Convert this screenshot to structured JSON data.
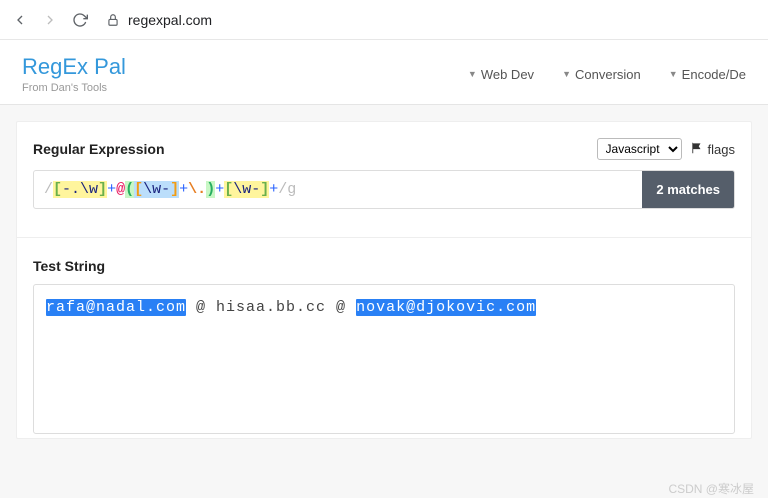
{
  "browser": {
    "url": "regexpal.com"
  },
  "header": {
    "logo": "RegEx Pal",
    "subtitle": "From Dan's Tools",
    "nav": {
      "web": "Web Dev",
      "conv": "Conversion",
      "enc": "Encode/De"
    }
  },
  "regex": {
    "title": "Regular Expression",
    "flavor_selected": "Javascript",
    "flags_label": "flags",
    "matches_label": "2 matches",
    "delim_open": "/",
    "delim_close": "/",
    "flag": "g",
    "tokens": {
      "br_open1": "[",
      "charclass1": "-.\\w",
      "br_close1": "]",
      "plus1": "+",
      "at": "@",
      "grp_open": "(",
      "br_open2": "[",
      "charclass2": "\\w-",
      "br_close2": "]",
      "plus2": "+",
      "escape_dot": "\\.",
      "grp_close": ")",
      "plus3": "+",
      "br_open3": "[",
      "charclass3": "\\w-",
      "br_close3": "]",
      "plus4": "+"
    }
  },
  "test": {
    "title": "Test String",
    "match1": "rafa@nadal.com",
    "mid": " @ hisaa.bb.cc @ ",
    "match2": "novak@djokovic.com"
  },
  "watermark": "CSDN @寒冰屋"
}
